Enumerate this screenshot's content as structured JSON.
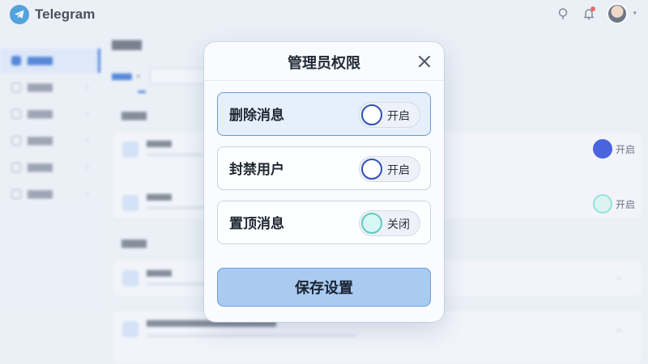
{
  "app": {
    "name": "Telegram"
  },
  "background": {
    "toggles": [
      {
        "label": "开启",
        "knob_color": "#1f3fd6",
        "state": "on"
      },
      {
        "label": "开启",
        "knob_color": "#d9f6f1",
        "state": "off"
      }
    ]
  },
  "modal": {
    "title": "管理员权限",
    "permissions": [
      {
        "label": "删除消息",
        "toggle_label": "开启",
        "state": "on",
        "selected": true
      },
      {
        "label": "封禁用户",
        "toggle_label": "开启",
        "state": "on",
        "selected": false
      },
      {
        "label": "置顶消息",
        "toggle_label": "关闭",
        "state": "off",
        "selected": false
      }
    ],
    "save_label": "保存设置"
  },
  "colors": {
    "accent": "#2f6fd0",
    "save_button": "#a9cbf2",
    "toggle_on_border": "#2f4fb8",
    "toggle_off_fill": "#d6f7f4",
    "alert_dot": "#e84848"
  },
  "icons": [
    "telegram-logo-icon",
    "location-pin-icon",
    "bell-icon",
    "close-icon",
    "chevron-down-icon"
  ]
}
